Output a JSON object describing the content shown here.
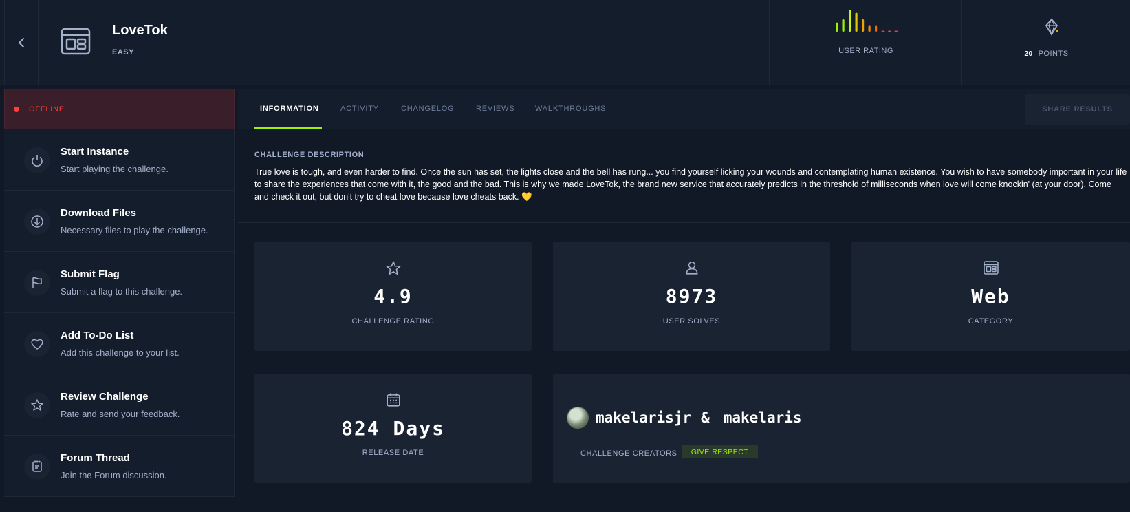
{
  "header": {
    "title": "LoveTok",
    "difficulty": "EASY",
    "user_rating_label": "USER RATING",
    "points_value": "20",
    "points_label": "POINTS",
    "rating_distribution": [
      2,
      3,
      6,
      5,
      3,
      1,
      1,
      0,
      0,
      0
    ],
    "rating_colors": [
      "#9fef00",
      "#9fef00",
      "#c5f015",
      "#e6c600",
      "#f0a400",
      "#f08a00",
      "#f06a00",
      "#e04040",
      "#e04040",
      "#e04040"
    ]
  },
  "sidebar": {
    "status": "OFFLINE",
    "actions": [
      {
        "title": "Start Instance",
        "subtitle": "Start playing the challenge.",
        "icon": "power-icon"
      },
      {
        "title": "Download Files",
        "subtitle": "Necessary files to play the challenge.",
        "icon": "download-icon"
      },
      {
        "title": "Submit Flag",
        "subtitle": "Submit a flag to this challenge.",
        "icon": "flag-icon"
      },
      {
        "title": "Add To-Do List",
        "subtitle": "Add this challenge to your list.",
        "icon": "heart-icon"
      },
      {
        "title": "Review Challenge",
        "subtitle": "Rate and send your feedback.",
        "icon": "star-icon"
      },
      {
        "title": "Forum Thread",
        "subtitle": "Join the Forum discussion.",
        "icon": "forum-icon"
      }
    ]
  },
  "tabs": [
    {
      "label": "INFORMATION",
      "active": true
    },
    {
      "label": "ACTIVITY",
      "active": false
    },
    {
      "label": "CHANGELOG",
      "active": false
    },
    {
      "label": "REVIEWS",
      "active": false
    },
    {
      "label": "WALKTHROUGHS",
      "active": false
    }
  ],
  "share_label": "SHARE RESULTS",
  "description": {
    "heading": "CHALLENGE DESCRIPTION",
    "text": "True love is tough, and even harder to find. Once the sun has set, the lights close and the bell has rung... you find yourself licking your wounds and contemplating human existence. You wish to have somebody important in your life to share the experiences that come with it, the good and the bad. This is why we made LoveTok, the brand new service that accurately predicts in the threshold of milliseconds when love will come knockin' (at your door). Come and check it out, but don't try to cheat love because love cheats back. 💛"
  },
  "stats": {
    "rating": {
      "value": "4.9",
      "label": "CHALLENGE RATING"
    },
    "solves": {
      "value": "8973",
      "label": "USER SOLVES"
    },
    "category": {
      "value": "Web",
      "label": "CATEGORY"
    },
    "release": {
      "value": "824 Days",
      "label": "RELEASE DATE"
    }
  },
  "creators": {
    "first": "makelarisjr",
    "separator": "&",
    "second": "makelaris",
    "label": "CHALLENGE CREATORS",
    "respect_label": "GIVE RESPECT"
  },
  "colors": {
    "accent": "#9fef00",
    "offline": "#ff3e3e",
    "background": "#111927",
    "panel": "#1a2332"
  }
}
